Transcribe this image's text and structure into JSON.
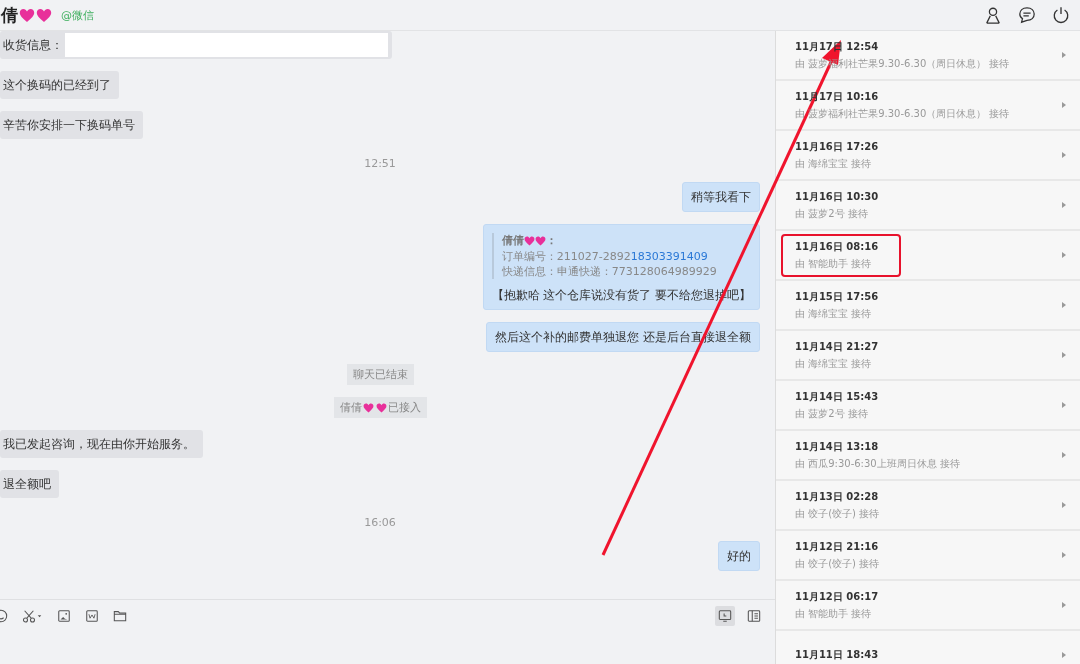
{
  "header": {
    "title": [
      {
        "kind": "text",
        "text": "倩"
      },
      {
        "kind": "heart"
      },
      {
        "kind": "heart"
      }
    ],
    "source": "@微信"
  },
  "messages": [
    {
      "kind": "form",
      "label": "收货信息："
    },
    {
      "kind": "incoming",
      "text": "这个换码的已经到了"
    },
    {
      "kind": "incoming",
      "text": "辛苦你安排一下换码单号"
    },
    {
      "kind": "time",
      "text": "12:51"
    },
    {
      "kind": "outgoing",
      "text": "稍等我看下"
    },
    {
      "kind": "quote",
      "sender": [
        {
          "kind": "text",
          "text": "倩倩"
        },
        {
          "kind": "heart"
        },
        {
          "kind": "heart"
        },
        {
          "kind": "text",
          "text": "："
        }
      ],
      "order_label": "订单编号：211027-2892",
      "order_link": "18303391409",
      "shipping": "快递信息：申通快递：773128064989929",
      "text": "【抱歉哈 这个仓库说没有货了 要不给您退掉吧】"
    },
    {
      "kind": "outgoing",
      "text": "然后这个补的邮费单独退您  还是后台直接退全额"
    },
    {
      "kind": "notice",
      "parts": [
        {
          "kind": "text",
          "text": "聊天已结束"
        }
      ]
    },
    {
      "kind": "notice",
      "parts": [
        {
          "kind": "text",
          "text": "倩倩"
        },
        {
          "kind": "heart"
        },
        {
          "kind": "heart"
        },
        {
          "kind": "text",
          "text": "已接入"
        }
      ]
    },
    {
      "kind": "incoming",
      "text": "我已发起咨询，现在由你开始服务。"
    },
    {
      "kind": "incoming",
      "text": "退全额吧"
    },
    {
      "kind": "time",
      "text": "16:06"
    },
    {
      "kind": "outgoing",
      "text": "好的"
    }
  ],
  "sessions": [
    {
      "time": "11月17日 12:54",
      "agent": "由 菠萝福利社芒果9.30-6.30（周日休息） 接待",
      "highlighted": false
    },
    {
      "time": "11月17日 10:16",
      "agent": "由 菠萝福利社芒果9.30-6.30（周日休息） 接待",
      "highlighted": false
    },
    {
      "time": "11月16日 17:26",
      "agent": "由 海绵宝宝 接待",
      "highlighted": false
    },
    {
      "time": "11月16日 10:30",
      "agent": "由 菠萝2号 接待",
      "highlighted": false
    },
    {
      "time": "11月16日 08:16",
      "agent": "由 智能助手 接待",
      "highlighted": true
    },
    {
      "time": "11月15日 17:56",
      "agent": "由 海绵宝宝 接待",
      "highlighted": false
    },
    {
      "time": "11月14日 21:27",
      "agent": "由 海绵宝宝 接待",
      "highlighted": false
    },
    {
      "time": "11月14日 15:43",
      "agent": "由 菠萝2号 接待",
      "highlighted": false
    },
    {
      "time": "11月14日 13:18",
      "agent": "由 西瓜9:30-6:30上班周日休息 接待",
      "highlighted": false
    },
    {
      "time": "11月13日 02:28",
      "agent": "由 饺子(饺子) 接待",
      "highlighted": false
    },
    {
      "time": "11月12日 21:16",
      "agent": "由 饺子(饺子) 接待",
      "highlighted": false
    },
    {
      "time": "11月12日 06:17",
      "agent": "由 智能助手 接待",
      "highlighted": false
    },
    {
      "time": "11月11日 18:43",
      "highlighted": false
    }
  ],
  "toolbar": {
    "view_selected": true
  }
}
